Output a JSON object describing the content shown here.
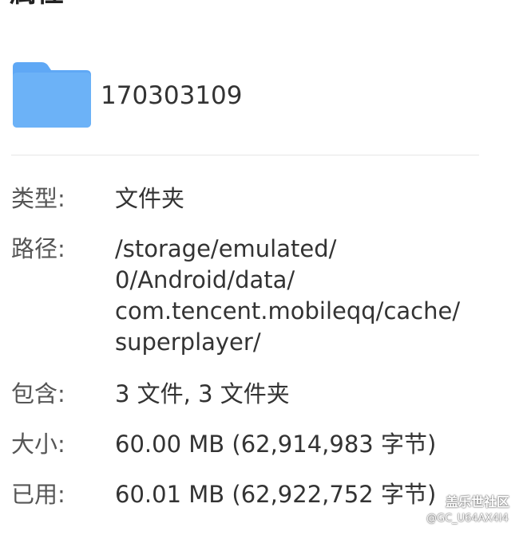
{
  "header": {
    "title": "属性"
  },
  "folder": {
    "icon": "folder-icon",
    "name": "170303109",
    "icon_color": "#5fa8f5"
  },
  "properties": {
    "type": {
      "label": "类型:",
      "value": "文件夹"
    },
    "path": {
      "label": "路径:",
      "lines": [
        "/storage/emulated/",
        "0/Android/data/",
        "com.tencent.mobileqq/cache/",
        "superplayer/"
      ]
    },
    "contains": {
      "label": "包含:",
      "value": "3 文件, 3 文件夹"
    },
    "size": {
      "label": "大小:",
      "value": "60.00 MB (62,914,983 字节)"
    },
    "used": {
      "label": "已用:",
      "value": "60.01 MB (62,922,752 字节)"
    }
  },
  "watermark": {
    "site": "盖乐世社区",
    "user": "@GC_U64AX4I4"
  }
}
